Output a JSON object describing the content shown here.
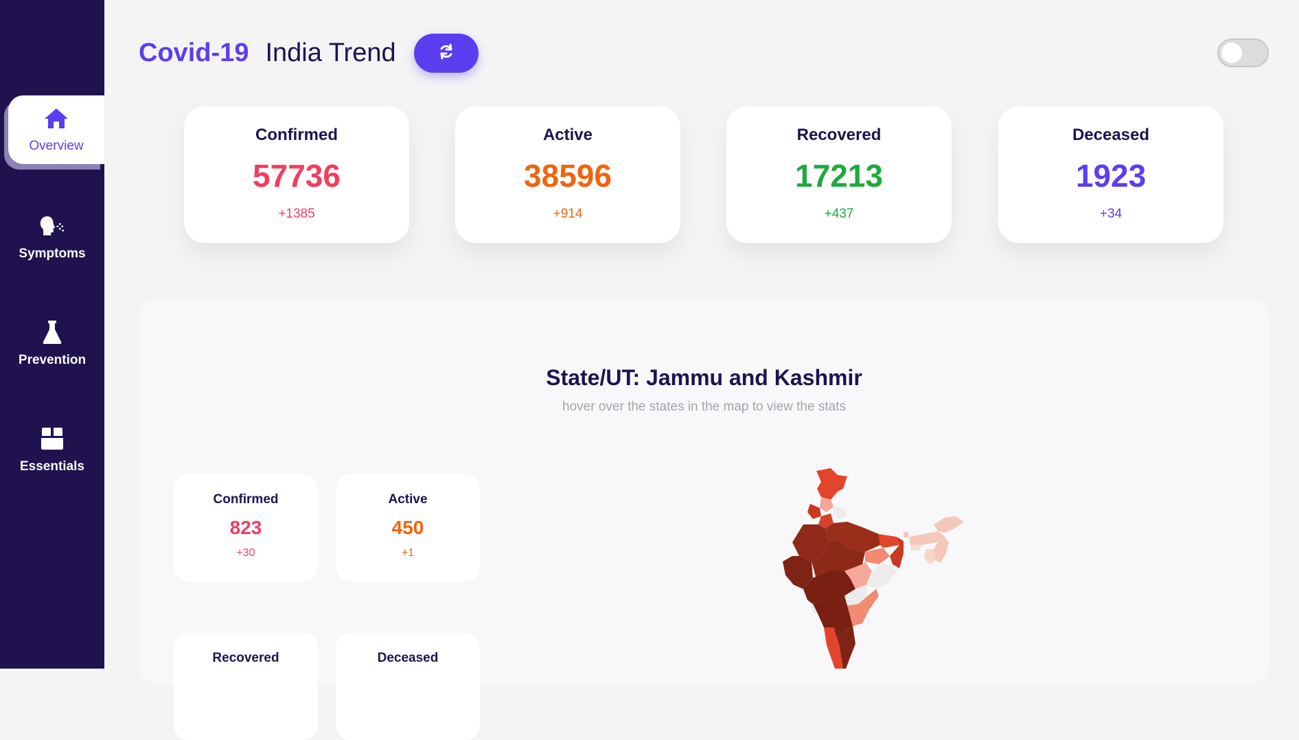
{
  "colors": {
    "sidebar": "#1f124f",
    "accent": "#5b3ef0",
    "confirmed": "#f03e5f",
    "active": "#f0640f",
    "recovered": "#1eaa3c",
    "deceased": "#5b3ef0"
  },
  "sidebar": {
    "items": [
      {
        "label": "Overview",
        "icon": "home-icon",
        "active": true
      },
      {
        "label": "Symptoms",
        "icon": "cough-icon",
        "active": false
      },
      {
        "label": "Prevention",
        "icon": "flask-icon",
        "active": false
      },
      {
        "label": "Essentials",
        "icon": "box-icon",
        "active": false
      }
    ]
  },
  "header": {
    "brand": "Covid-19",
    "title": "India Trend",
    "refresh_icon": "refresh-icon",
    "theme_toggle_on": false
  },
  "summary": {
    "confirmed": {
      "label": "Confirmed",
      "value": "57736",
      "delta": "+1385"
    },
    "active": {
      "label": "Active",
      "value": "38596",
      "delta": "+914"
    },
    "recovered": {
      "label": "Recovered",
      "value": "17213",
      "delta": "+437"
    },
    "deceased": {
      "label": "Deceased",
      "value": "1923",
      "delta": "+34"
    }
  },
  "state": {
    "title": "State/UT: Jammu and Kashmir",
    "hint": "hover over the states in the map to view the stats",
    "confirmed": {
      "label": "Confirmed",
      "value": "823",
      "delta": "+30"
    },
    "active": {
      "label": "Active",
      "value": "450",
      "delta": "+1"
    },
    "recovered": {
      "label": "Recovered"
    },
    "deceased": {
      "label": "Deceased"
    }
  }
}
